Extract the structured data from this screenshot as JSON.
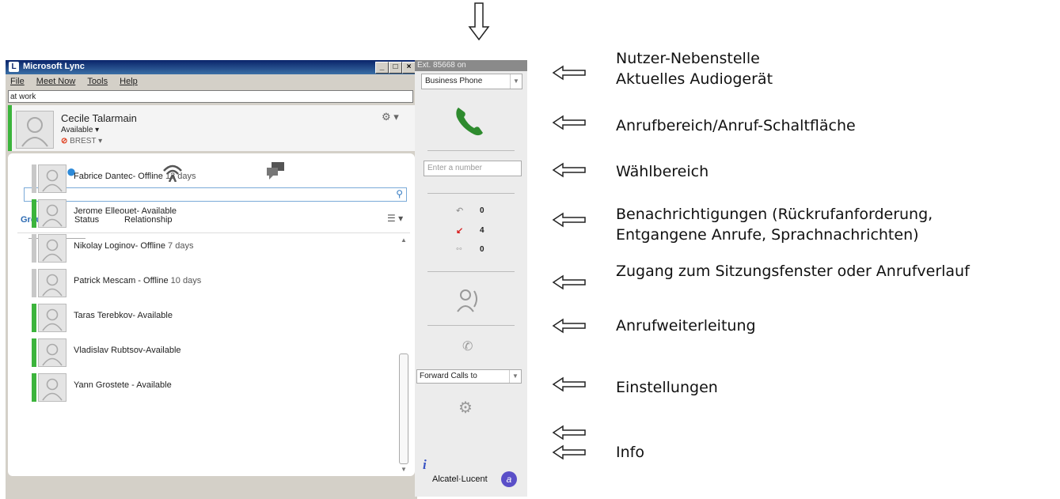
{
  "window": {
    "title": "Microsoft Lync",
    "menu": [
      "File",
      "Meet Now",
      "Tools",
      "Help"
    ],
    "personal_note": "at work"
  },
  "me": {
    "name": "Cecile Talarmain",
    "status": "Available ▾",
    "location": "BREST"
  },
  "contacts_panel": {
    "search_placeholder": "",
    "tabs": [
      "Groups",
      "Status",
      "Relationship"
    ],
    "contacts": [
      {
        "name": "Fabrice Dantec- Offline",
        "days": "13 days",
        "presence": "offline"
      },
      {
        "name": "Jerome Elleouet- Available",
        "days": "",
        "presence": "available"
      },
      {
        "name": "Nikolay Loginov- Offline",
        "days": "7 days",
        "presence": "offline"
      },
      {
        "name": "Patrick Mescam - Offline",
        "days": "10 days",
        "presence": "offline"
      },
      {
        "name": "Taras Terebkov- Available",
        "days": "",
        "presence": "available"
      },
      {
        "name": "Vladislav Rubtsov-Available",
        "days": "",
        "presence": "available"
      },
      {
        "name": "Yann Grostete - Available",
        "days": "",
        "presence": "available"
      }
    ]
  },
  "sidebar": {
    "extension": "Ext. 85668 on",
    "audio_device": "Business Phone",
    "dial_placeholder": "Enter a number",
    "callback_count": "0",
    "missed_count": "4",
    "voicemail_count": "0",
    "forward_label": "Forward Calls to",
    "brand": "Alcatel·Lucent"
  },
  "annotations": [
    "Nutzer-Nebenstelle",
    "Aktuelles Audiogerät",
    "Anrufbereich/Anruf-Schaltfläche",
    "Wählbereich",
    "Benachrichtigungen (Rückrufanforderung,",
    "Entgangene Anrufe, Sprachnachrichten)",
    "Zugang zum Sitzungsfenster oder Anrufverlauf",
    "Anrufweiterleitung",
    "Einstellungen",
    "Info"
  ],
  "colors": {
    "available": "#3cb43c",
    "offline": "#c8c8c8",
    "accent": "#2d6bb3",
    "missed": "#d81e1e",
    "call_green": "#2e8b2e"
  }
}
